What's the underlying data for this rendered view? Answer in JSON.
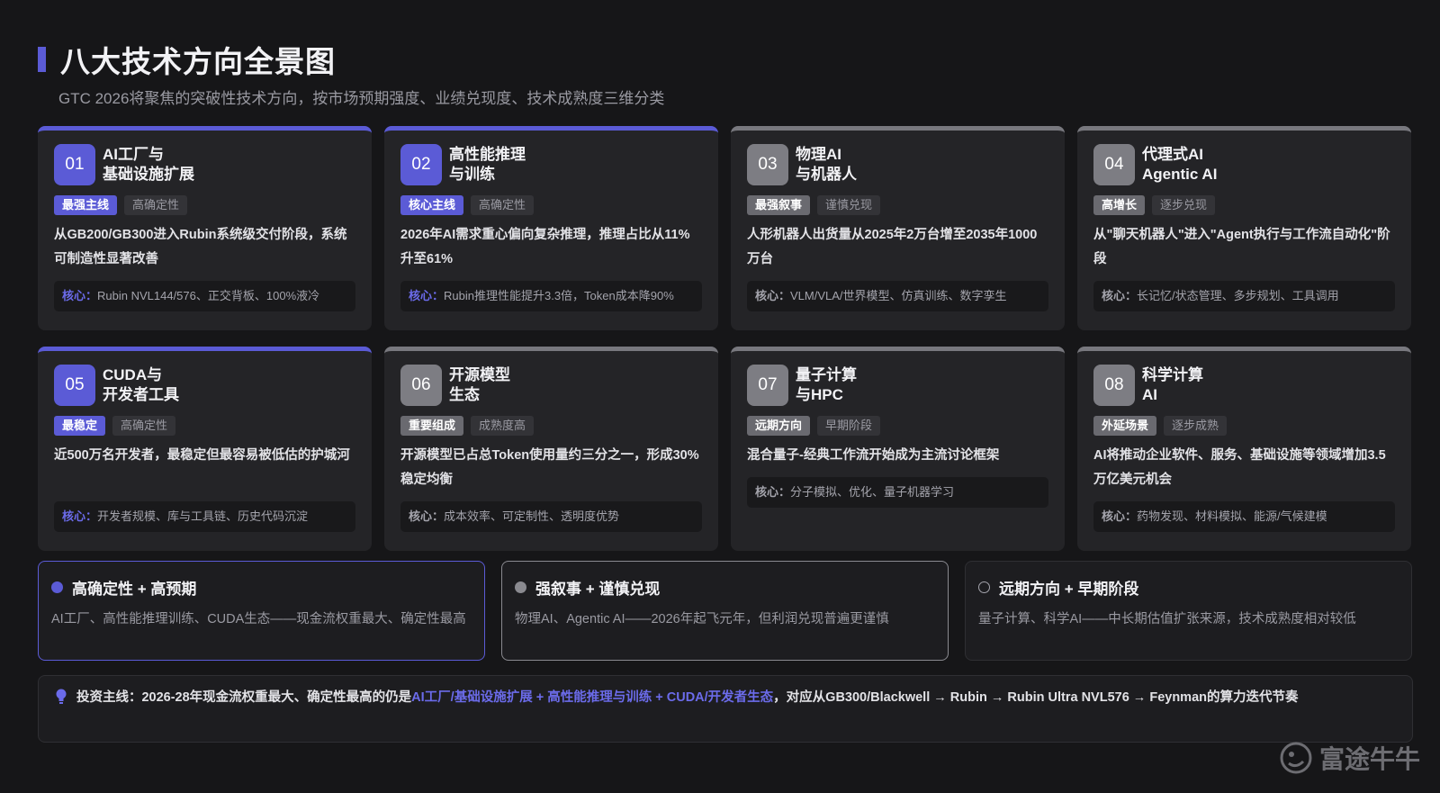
{
  "header": {
    "title": "八大技术方向全景图",
    "subtitle": "GTC 2026将聚焦的突破性技术方向，按市场预期强度、业绩兑现度、技术成熟度三维分类"
  },
  "cards": [
    {
      "num": "01",
      "title1": "AI工厂与",
      "title2": "基础设施扩展",
      "tag1": "最强主线",
      "tag2": "高确定性",
      "desc": "从GB200/GB300进入Rubin系统级交付阶段，系统可制造性显著改善",
      "core_label": "核心：",
      "core": "Rubin NVL144/576、正交背板、100%液冷"
    },
    {
      "num": "02",
      "title1": "高性能推理",
      "title2": "与训练",
      "tag1": "核心主线",
      "tag2": "高确定性",
      "desc": "2026年AI需求重心偏向复杂推理，推理占比从11%升至61%",
      "core_label": "核心：",
      "core": "Rubin推理性能提升3.3倍，Token成本降90%"
    },
    {
      "num": "03",
      "title1": "物理AI",
      "title2": "与机器人",
      "tag1": "最强叙事",
      "tag2": "谨慎兑现",
      "desc": "人形机器人出货量从2025年2万台增至2035年1000万台",
      "core_label": "核心：",
      "core": "VLM/VLA/世界模型、仿真训练、数字孪生"
    },
    {
      "num": "04",
      "title1": "代理式AI",
      "title2": "Agentic AI",
      "tag1": "高增长",
      "tag2": "逐步兑现",
      "desc": "从\"聊天机器人\"进入\"Agent执行与工作流自动化\"阶段",
      "core_label": "核心：",
      "core": "长记忆/状态管理、多步规划、工具调用"
    },
    {
      "num": "05",
      "title1": "CUDA与",
      "title2": "开发者工具",
      "tag1": "最稳定",
      "tag2": "高确定性",
      "desc": "近500万名开发者，最稳定但最容易被低估的护城河",
      "core_label": "核心：",
      "core": "开发者规模、库与工具链、历史代码沉淀"
    },
    {
      "num": "06",
      "title1": "开源模型",
      "title2": "生态",
      "tag1": "重要组成",
      "tag2": "成熟度高",
      "desc": "开源模型已占总Token使用量约三分之一，形成30%稳定均衡",
      "core_label": "核心：",
      "core": "成本效率、可定制性、透明度优势"
    },
    {
      "num": "07",
      "title1": "量子计算",
      "title2": "与HPC",
      "tag1": "远期方向",
      "tag2": "早期阶段",
      "desc": "混合量子-经典工作流开始成为主流讨论框架",
      "core_label": "核心：",
      "core": "分子模拟、优化、量子机器学习"
    },
    {
      "num": "08",
      "title1": "科学计算",
      "title2": "AI",
      "tag1": "外延场景",
      "tag2": "逐步成熟",
      "desc": "AI将推动企业软件、服务、基础设施等领域增加3.5万亿美元机会",
      "core_label": "核心：",
      "core": "药物发现、材料模拟、能源/气候建模"
    }
  ],
  "legend": [
    {
      "title": "高确定性 + 高预期",
      "body": "AI工厂、高性能推理训练、CUDA生态——现金流权重最大、确定性最高"
    },
    {
      "title": "强叙事 + 谨慎兑现",
      "body": "物理AI、Agentic AI——2026年起飞元年，但利润兑现普遍更谨慎"
    },
    {
      "title": "远期方向 + 早期阶段",
      "body": "量子计算、科学AI——中长期估值扩张来源，技术成熟度相对较低"
    }
  ],
  "bottom": {
    "prefix": "投资主线：2026-28年现金流权重最大、确定性最高的仍是",
    "highlight": "AI工厂/基础设施扩展 + 高性能推理与训练 + CUDA/开发者生态",
    "suffix": "，对应从GB300/Blackwell → Rubin → Rubin Ultra NVL576 → Feynman的算力迭代节奏"
  },
  "watermark": {
    "text": "富途牛牛",
    "icon": "futu-logo-icon"
  },
  "colors": {
    "accent": "#5b5bd6",
    "background": "#161618",
    "card": "#242427"
  }
}
